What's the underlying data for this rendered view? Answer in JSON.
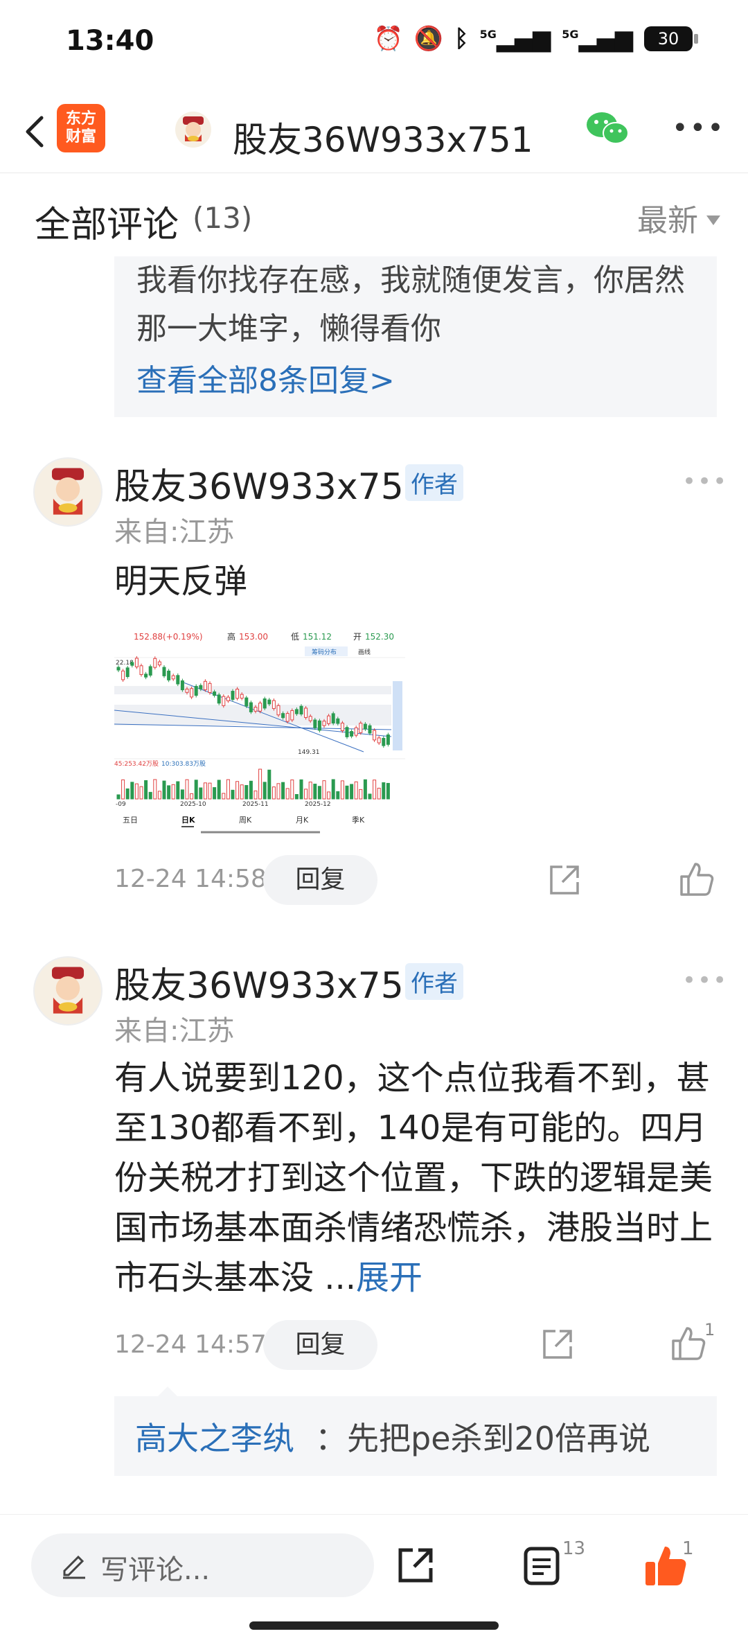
{
  "status_bar": {
    "time": "13:40",
    "battery": "30",
    "signal1": "5G",
    "signal2": "5G"
  },
  "nav": {
    "title": "股友36W933x751",
    "logo_text_line1": "东方",
    "logo_text_line2": "财富"
  },
  "comments_header": {
    "title": "全部评论",
    "count": "(13)",
    "sort_label": "最新"
  },
  "reply_box_top": {
    "text": "我看你找存在感，我就随便发言，你居然那一大堆字，懒得看你",
    "link": "查看全部8条回复>"
  },
  "comments": [
    {
      "name": "股友36W933x751",
      "badge": "作者",
      "location": "来自:江苏",
      "body": "明天反弹",
      "time": "12-24 14:58",
      "reply_label": "回复"
    },
    {
      "name": "股友36W933x751",
      "badge": "作者",
      "location": "来自:江苏",
      "body": "有人说要到120，这个点位我看不到，甚至130都看不到，140是有可能的。四月份关税才打到这个位置，下跌的逻辑是美国市场基本面杀情绪恐慌杀，港股当时上市石头基本没 ...",
      "expand": "展开",
      "time": "12-24 14:57",
      "reply_label": "回复",
      "like_count": "1",
      "sub_reply": {
        "name": "高大之李纨",
        "text": "：先把pe杀到20倍再说"
      }
    }
  ],
  "chart_image": {
    "price": "152.88(+0.19%)",
    "high_label": "高",
    "high": "153.00",
    "low_label": "低",
    "low": "151.12",
    "open_label": "开",
    "open": "152.30",
    "chip_label": "筹码分布",
    "draw_label": "画线",
    "max_label": "22.18",
    "min_label": "149.31",
    "vol_text": "45:253.42万股",
    "vol10_text": "10:303.83万股",
    "dates": [
      "-09",
      "2025-10",
      "2025-11",
      "2025-12"
    ],
    "tabs": [
      "五日",
      "日K",
      "周K",
      "月K",
      "季K"
    ]
  },
  "bottom_bar": {
    "compose_placeholder": "写评论...",
    "comment_count": "13",
    "like_count": "1"
  },
  "colors": {
    "accent_blue": "#2a6fb8",
    "brand_orange": "#ff5a1f",
    "like_orange": "#ff5a1f"
  }
}
